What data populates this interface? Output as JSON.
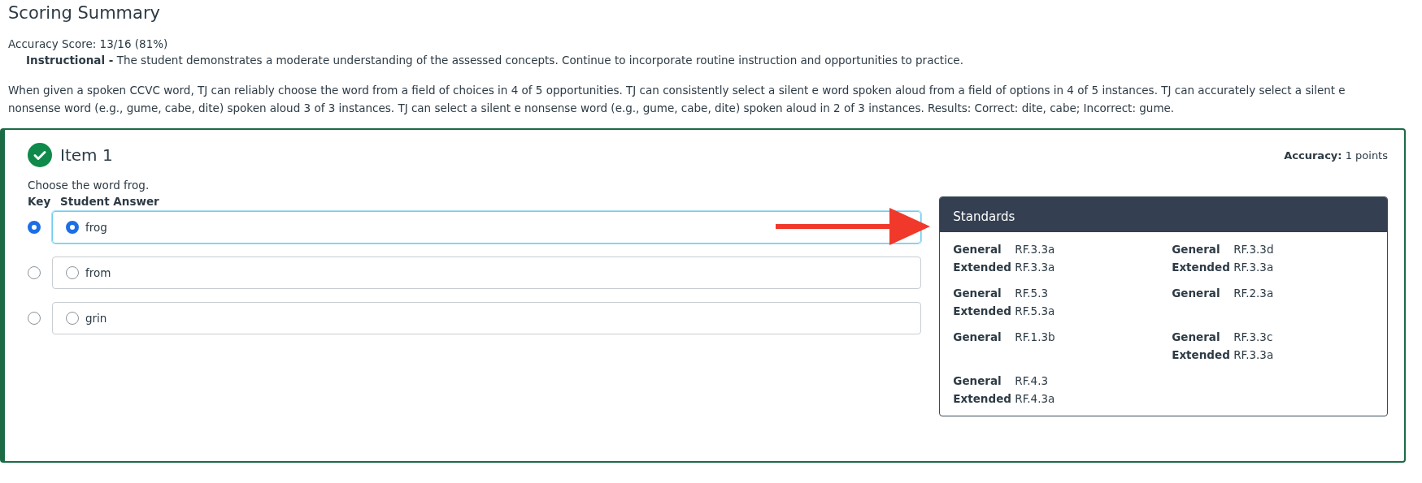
{
  "title": "Scoring Summary",
  "accuracy_score": "Accuracy Score: 13/16 (81%)",
  "level_note": "**Instructional -** The student demonstrates a moderate understanding of the assessed concepts. Continue to incorporate routine instruction and opportunities to practice.",
  "summary": "When given a spoken CCVC word, TJ can reliably choose the word from a field of choices in 4 of 5 opportunities. TJ can consistently select a silent e word spoken aloud from a field of options in 4 of 5 instances. TJ can accurately select a silent e nonsense word (e.g., gume, cabe, dite) spoken aloud 3 of 3 instances. TJ can select a silent e nonsense word (e.g., gume, cabe, dite) spoken aloud in 2 of 3 instances. Results: Correct: dite, cabe; Incorrect: gume.",
  "item": {
    "title": "Item 1",
    "correct": true,
    "accuracy_label": "Accuracy:",
    "accuracy_value": "1 points",
    "prompt": "Choose the word frog.",
    "key_header": "Key",
    "answer_header": "Student Answer",
    "options": [
      {
        "label": "frog",
        "key": true,
        "selected": true
      },
      {
        "label": "from",
        "key": false,
        "selected": false
      },
      {
        "label": "grin",
        "key": false,
        "selected": false
      }
    ],
    "standards": {
      "title": "Standards",
      "groups": [
        {
          "rows": [
            {
              "label": "General",
              "code": "RF.3.3a"
            },
            {
              "label": "Extended",
              "code": "RF.3.3a"
            }
          ]
        },
        {
          "rows": [
            {
              "label": "General",
              "code": "RF.3.3d"
            },
            {
              "label": "Extended",
              "code": "RF.3.3a"
            }
          ]
        },
        {
          "rows": [
            {
              "label": "General",
              "code": "RF.5.3"
            },
            {
              "label": "Extended",
              "code": "RF.5.3a"
            }
          ]
        },
        {
          "rows": [
            {
              "label": "General",
              "code": "RF.2.3a"
            }
          ]
        },
        {
          "rows": [
            {
              "label": "General",
              "code": "RF.1.3b"
            }
          ]
        },
        {
          "rows": [
            {
              "label": "General",
              "code": "RF.3.3c"
            },
            {
              "label": "Extended",
              "code": "RF.3.3a"
            }
          ]
        },
        {
          "rows": [
            {
              "label": "General",
              "code": "RF.4.3"
            },
            {
              "label": "Extended",
              "code": "RF.4.3a"
            }
          ]
        }
      ]
    }
  }
}
